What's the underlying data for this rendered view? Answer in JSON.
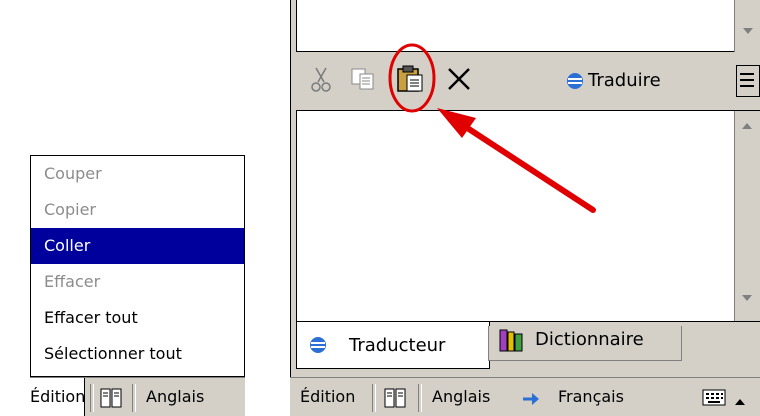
{
  "edit_menu": {
    "items": [
      {
        "label": "Couper",
        "state": "disabled"
      },
      {
        "label": "Copier",
        "state": "disabled"
      },
      {
        "label": "Coller",
        "state": "selected"
      },
      {
        "label": "Effacer",
        "state": "disabled"
      },
      {
        "label": "Effacer tout",
        "state": "enabled"
      },
      {
        "label": "Sélectionner tout",
        "state": "enabled"
      }
    ],
    "highlight_color": "#00009c"
  },
  "left_bar": {
    "edition_label": "Édition",
    "language_label": "Anglais"
  },
  "toolbar": {
    "cut_icon": "scissors-icon",
    "copy_icon": "copy-icon",
    "paste_icon": "paste-icon",
    "delete_icon": "delete-x-icon",
    "translate_label": "Traduire",
    "menu_icon": "hamburger-menu-icon"
  },
  "tabs": [
    {
      "label": "Traducteur",
      "icon": "translator-icon",
      "active": true
    },
    {
      "label": "Dictionnaire",
      "icon": "dictionary-books-icon",
      "active": false
    }
  ],
  "right_bar": {
    "edition_label": "Édition",
    "source_language": "Anglais",
    "target_language": "Français",
    "keyboard_icon": "keyboard-icon",
    "arrow_icon": "right-arrow-icon"
  },
  "annotation": {
    "type": "circle-and-arrow",
    "target": "paste-icon",
    "color": "#e00000"
  }
}
